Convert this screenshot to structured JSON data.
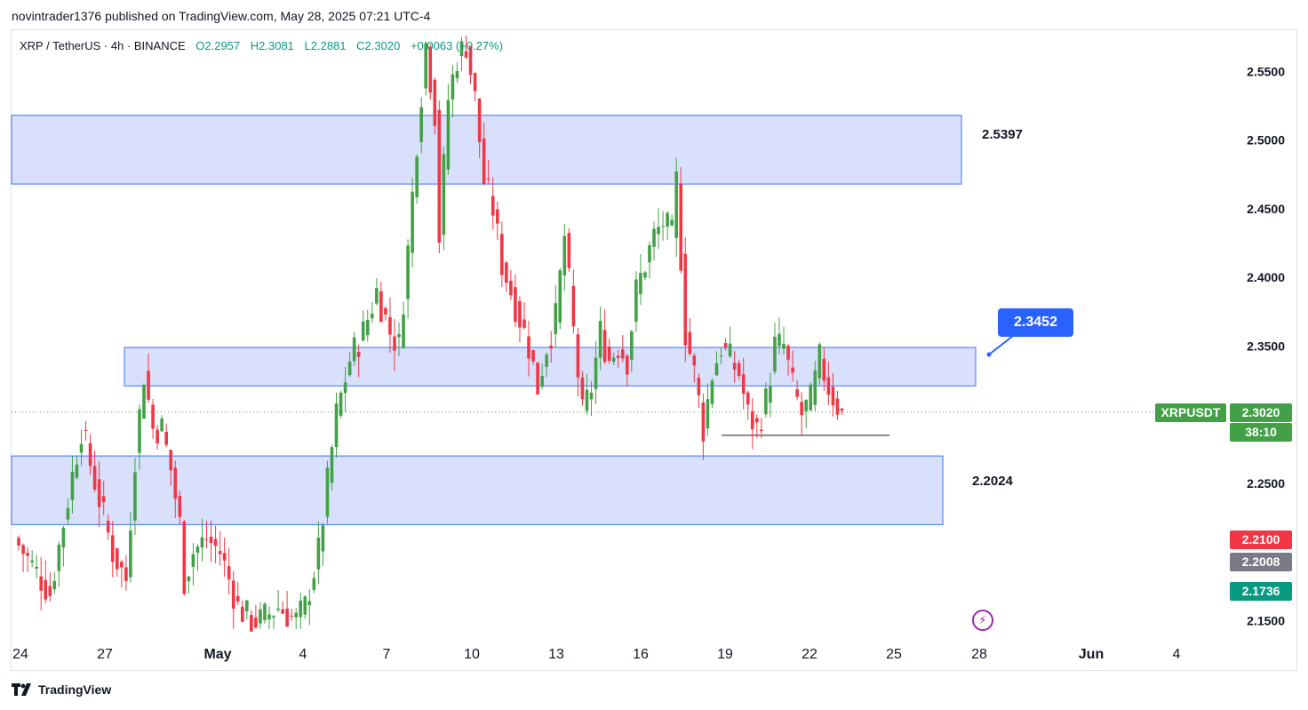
{
  "publish": {
    "text": "novintrader1376 published on TradingView.com, May 28, 2025 07:21 UTC-4"
  },
  "symbol": {
    "name": "XRP / TetherUS · 4h · BINANCE",
    "open": "O2.2957",
    "high": "H2.3081",
    "low": "L2.2881",
    "close": "C2.3020",
    "change": "+0.0063 (+0.27%)"
  },
  "brand": {
    "name": "TradingView"
  },
  "colors": {
    "up": "#43a047",
    "down": "#f23645",
    "zone_fill": "#d4ddfc",
    "zone_border": "#2962ff"
  },
  "chart_data": {
    "type": "candlestick",
    "ylim": [
      2.14,
      2.58
    ],
    "y_ticks": [
      "2.5500",
      "2.5000",
      "2.4500",
      "2.4000",
      "2.3500",
      "2.2500",
      "2.1500"
    ],
    "x_ticks": [
      "24",
      "27",
      "May",
      "4",
      "7",
      "10",
      "13",
      "16",
      "19",
      "22",
      "25",
      "28",
      "Jun",
      "4"
    ],
    "zones": [
      {
        "name": "resistance-zone",
        "y_top": 2.518,
        "y_bottom": 2.468
      },
      {
        "name": "mid-zone",
        "y_top": 2.349,
        "y_bottom": 2.321
      },
      {
        "name": "support-zone",
        "y_top": 2.27,
        "y_bottom": 2.22
      }
    ],
    "levels": [
      {
        "label": "2.5397",
        "value": 2.5397
      },
      {
        "label": "2.2024",
        "value": 2.2024
      },
      {
        "label": "2.3452",
        "value": 2.3452
      }
    ],
    "support_line": {
      "value": 2.285
    },
    "current_price": {
      "label": "XRPUSDT",
      "value": "2.3020",
      "countdown": "38:10"
    },
    "axis_tags": [
      {
        "value": "2.2100",
        "color": "#f23645"
      },
      {
        "value": "2.2008",
        "color": "#787b86"
      },
      {
        "value": "2.1736",
        "color": "#089981"
      }
    ],
    "path": [
      [
        0,
        2.21
      ],
      [
        8,
        2.17
      ],
      [
        15,
        2.29
      ],
      [
        22,
        2.2
      ],
      [
        25,
        2.18
      ],
      [
        27,
        2.27
      ],
      [
        29,
        2.33
      ],
      [
        31,
        2.29
      ],
      [
        33,
        2.29
      ],
      [
        35,
        2.26
      ],
      [
        37,
        2.22
      ],
      [
        38,
        2.18
      ],
      [
        40,
        2.2
      ],
      [
        43,
        2.21
      ],
      [
        46,
        2.2
      ],
      [
        48,
        2.18
      ],
      [
        50,
        2.16
      ],
      [
        53,
        2.15
      ],
      [
        55,
        2.15
      ],
      [
        59,
        2.16
      ],
      [
        63,
        2.15
      ],
      [
        65,
        2.16
      ],
      [
        68,
        2.2
      ],
      [
        70,
        2.25
      ],
      [
        72,
        2.3
      ],
      [
        75,
        2.34
      ],
      [
        78,
        2.36
      ],
      [
        81,
        2.39
      ],
      [
        84,
        2.36
      ],
      [
        86,
        2.35
      ],
      [
        88,
        2.42
      ],
      [
        90,
        2.5
      ],
      [
        92,
        2.57
      ],
      [
        94,
        2.52
      ],
      [
        95,
        2.43
      ],
      [
        97,
        2.53
      ],
      [
        99,
        2.56
      ],
      [
        101,
        2.57
      ],
      [
        103,
        2.53
      ],
      [
        105,
        2.47
      ],
      [
        107,
        2.45
      ],
      [
        109,
        2.41
      ],
      [
        111,
        2.39
      ],
      [
        113,
        2.37
      ],
      [
        115,
        2.35
      ],
      [
        117,
        2.32
      ],
      [
        119,
        2.35
      ],
      [
        121,
        2.37
      ],
      [
        123,
        2.43
      ],
      [
        125,
        2.36
      ],
      [
        127,
        2.3
      ],
      [
        129,
        2.32
      ],
      [
        131,
        2.36
      ],
      [
        133,
        2.34
      ],
      [
        135,
        2.35
      ],
      [
        137,
        2.34
      ],
      [
        139,
        2.39
      ],
      [
        141,
        2.41
      ],
      [
        143,
        2.43
      ],
      [
        145,
        2.44
      ],
      [
        147,
        2.43
      ],
      [
        148,
        2.47
      ],
      [
        150,
        2.36
      ],
      [
        152,
        2.33
      ],
      [
        154,
        2.29
      ],
      [
        156,
        2.33
      ],
      [
        158,
        2.35
      ],
      [
        160,
        2.34
      ],
      [
        162,
        2.33
      ],
      [
        164,
        2.3
      ],
      [
        166,
        2.29
      ],
      [
        168,
        2.31
      ],
      [
        170,
        2.35
      ],
      [
        172,
        2.35
      ],
      [
        174,
        2.32
      ],
      [
        176,
        2.3
      ],
      [
        178,
        2.31
      ],
      [
        180,
        2.34
      ],
      [
        182,
        2.32
      ],
      [
        185,
        2.3
      ]
    ]
  }
}
